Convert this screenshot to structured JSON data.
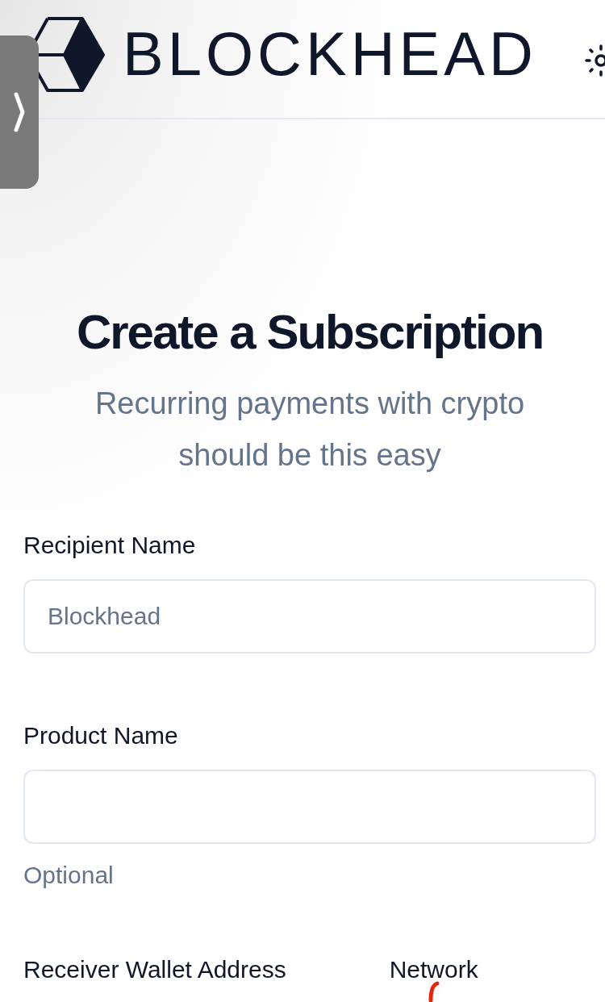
{
  "header": {
    "brand": "BLOCKHEAD"
  },
  "page": {
    "title": "Create a Subscription",
    "subtitle": "Recurring payments with crypto should be this easy"
  },
  "fields": [
    {
      "label": "Recipient Name",
      "placeholder": "Blockhead"
    },
    {
      "label": "Product Name",
      "hint": "Optional"
    }
  ],
  "bottom_labels": [
    {
      "label": "Receiver Wallet Address"
    },
    {
      "label": "Network"
    }
  ]
}
